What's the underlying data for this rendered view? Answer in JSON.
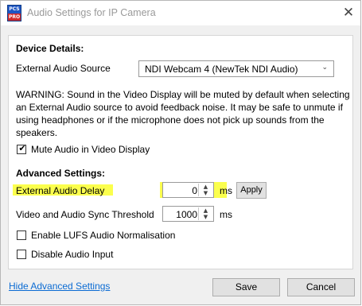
{
  "window": {
    "title": "Audio Settings for IP Camera",
    "icon_top": "PCS",
    "icon_bottom": "PRO",
    "close_glyph": "✕"
  },
  "device_details": {
    "heading": "Device Details:",
    "external_source_label": "External Audio Source",
    "external_source_value": "NDI Webcam 4 (NewTek NDI Audio)",
    "warning": "WARNING: Sound in the Video Display will be muted by default when selecting an External Audio source to avoid feedback noise. It may be safe to unmute if using headphones or if the microphone does not pick up sounds from the speakers.",
    "mute_label": "Mute Audio in Video Display",
    "mute_checked": true
  },
  "advanced": {
    "heading": "Advanced Settings:",
    "delay_label": "External Audio Delay",
    "delay_value": "0",
    "delay_unit": "ms",
    "apply_label": "Apply",
    "sync_label": "Video and Audio Sync Threshold",
    "sync_value": "1000",
    "sync_unit": "ms",
    "lufs_label": "Enable LUFS Audio Normalisation",
    "lufs_checked": false,
    "disable_input_label": "Disable Audio Input",
    "disable_input_checked": false
  },
  "footer": {
    "hide_link": "Hide Advanced Settings",
    "save_label": "Save",
    "cancel_label": "Cancel"
  },
  "colors": {
    "highlight": "#fbff4d",
    "link": "#0b6bd3"
  },
  "icons": {
    "dropdown": "chevron-down-icon",
    "spin_up": "▲",
    "spin_down": "▼",
    "check": "✔"
  }
}
